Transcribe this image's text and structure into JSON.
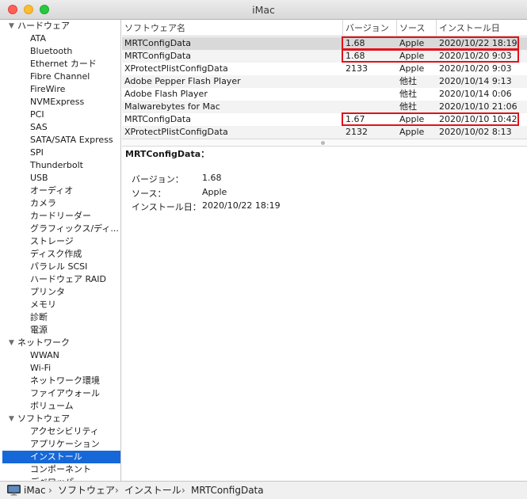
{
  "window": {
    "title": "iMac"
  },
  "sidebar": {
    "groups": [
      {
        "label": "ハードウェア",
        "items": [
          "ATA",
          "Bluetooth",
          "Ethernet カード",
          "Fibre Channel",
          "FireWire",
          "NVMExpress",
          "PCI",
          "SAS",
          "SATA/SATA Express",
          "SPI",
          "Thunderbolt",
          "USB",
          "オーディオ",
          "カメラ",
          "カードリーダー",
          "グラフィックス/ディ...",
          "ストレージ",
          "ディスク作成",
          "パラレル SCSI",
          "ハードウェア RAID",
          "プリンタ",
          "メモリ",
          "診断",
          "電源"
        ]
      },
      {
        "label": "ネットワーク",
        "items": [
          "WWAN",
          "Wi-Fi",
          "ネットワーク環境",
          "ファイアウォール",
          "ボリューム"
        ]
      },
      {
        "label": "ソフトウェア",
        "items": [
          "アクセシビリティ",
          "アプリケーション",
          "インストール",
          "コンポーネント",
          "デベロッパ"
        ]
      }
    ],
    "selected": "インストール"
  },
  "table": {
    "columns": [
      "ソフトウェア名",
      "バージョン",
      "ソース",
      "インストール日"
    ],
    "rows": [
      {
        "name": "MRTConfigData",
        "version": "1.68",
        "source": "Apple",
        "date": "2020/10/22 18:19",
        "selected": true,
        "highlighted": true
      },
      {
        "name": "MRTConfigData",
        "version": "1.68",
        "source": "Apple",
        "date": "2020/10/20 9:03",
        "highlighted": true
      },
      {
        "name": "XProtectPlistConfigData",
        "version": "2133",
        "source": "Apple",
        "date": "2020/10/20 9:03"
      },
      {
        "name": "Adobe Pepper Flash Player",
        "version": "",
        "source": "他社",
        "date": "2020/10/14 9:13"
      },
      {
        "name": "Adobe Flash Player",
        "version": "",
        "source": "他社",
        "date": "2020/10/14 0:06"
      },
      {
        "name": "Malwarebytes for Mac",
        "version": "",
        "source": "他社",
        "date": "2020/10/10 21:06"
      },
      {
        "name": "MRTConfigData",
        "version": "1.67",
        "source": "Apple",
        "date": "2020/10/10 10:42",
        "highlighted": true
      },
      {
        "name": "XProtectPlistConfigData",
        "version": "2132",
        "source": "Apple",
        "date": "2020/10/02 8:13"
      }
    ]
  },
  "detail": {
    "title": "MRTConfigData：",
    "fields": [
      {
        "label": "バージョン：",
        "value": "1.68"
      },
      {
        "label": "ソース：",
        "value": "Apple"
      },
      {
        "label": "インストール日：",
        "value": "2020/10/22 18:19"
      }
    ]
  },
  "pathbar": {
    "crumbs": [
      "iMac",
      "ソフトウェア",
      "インストール",
      "MRTConfigData"
    ],
    "separator": "›"
  },
  "colors": {
    "selection": "#1668d8",
    "highlight_box": "#e0121a",
    "selected_row": "#d9d9d9"
  }
}
